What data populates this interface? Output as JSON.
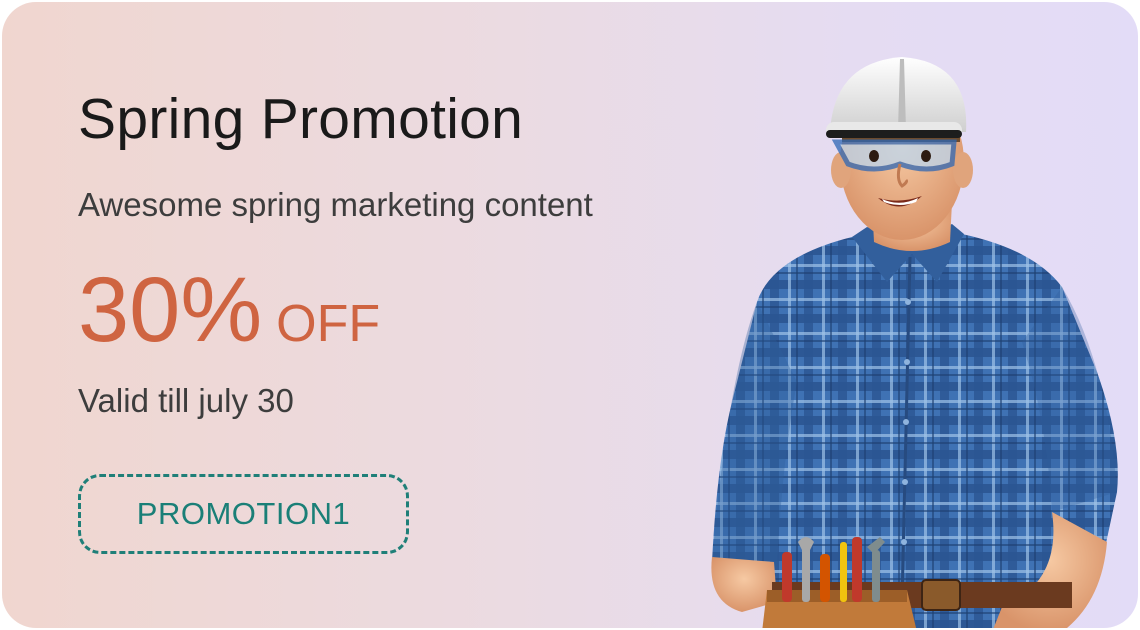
{
  "promo": {
    "title": "Spring Promotion",
    "subtitle": "Awesome spring marketing content",
    "discount_value": "30%",
    "discount_label": "OFF",
    "validity": "Valid till july 30",
    "code": "PROMOTION1"
  },
  "colors": {
    "accent": "#cf6441",
    "code_border": "#1f7f78",
    "background_start": "#f0d6cf",
    "background_end": "#e3dcf7"
  },
  "illustration": "construction-worker-illustration"
}
